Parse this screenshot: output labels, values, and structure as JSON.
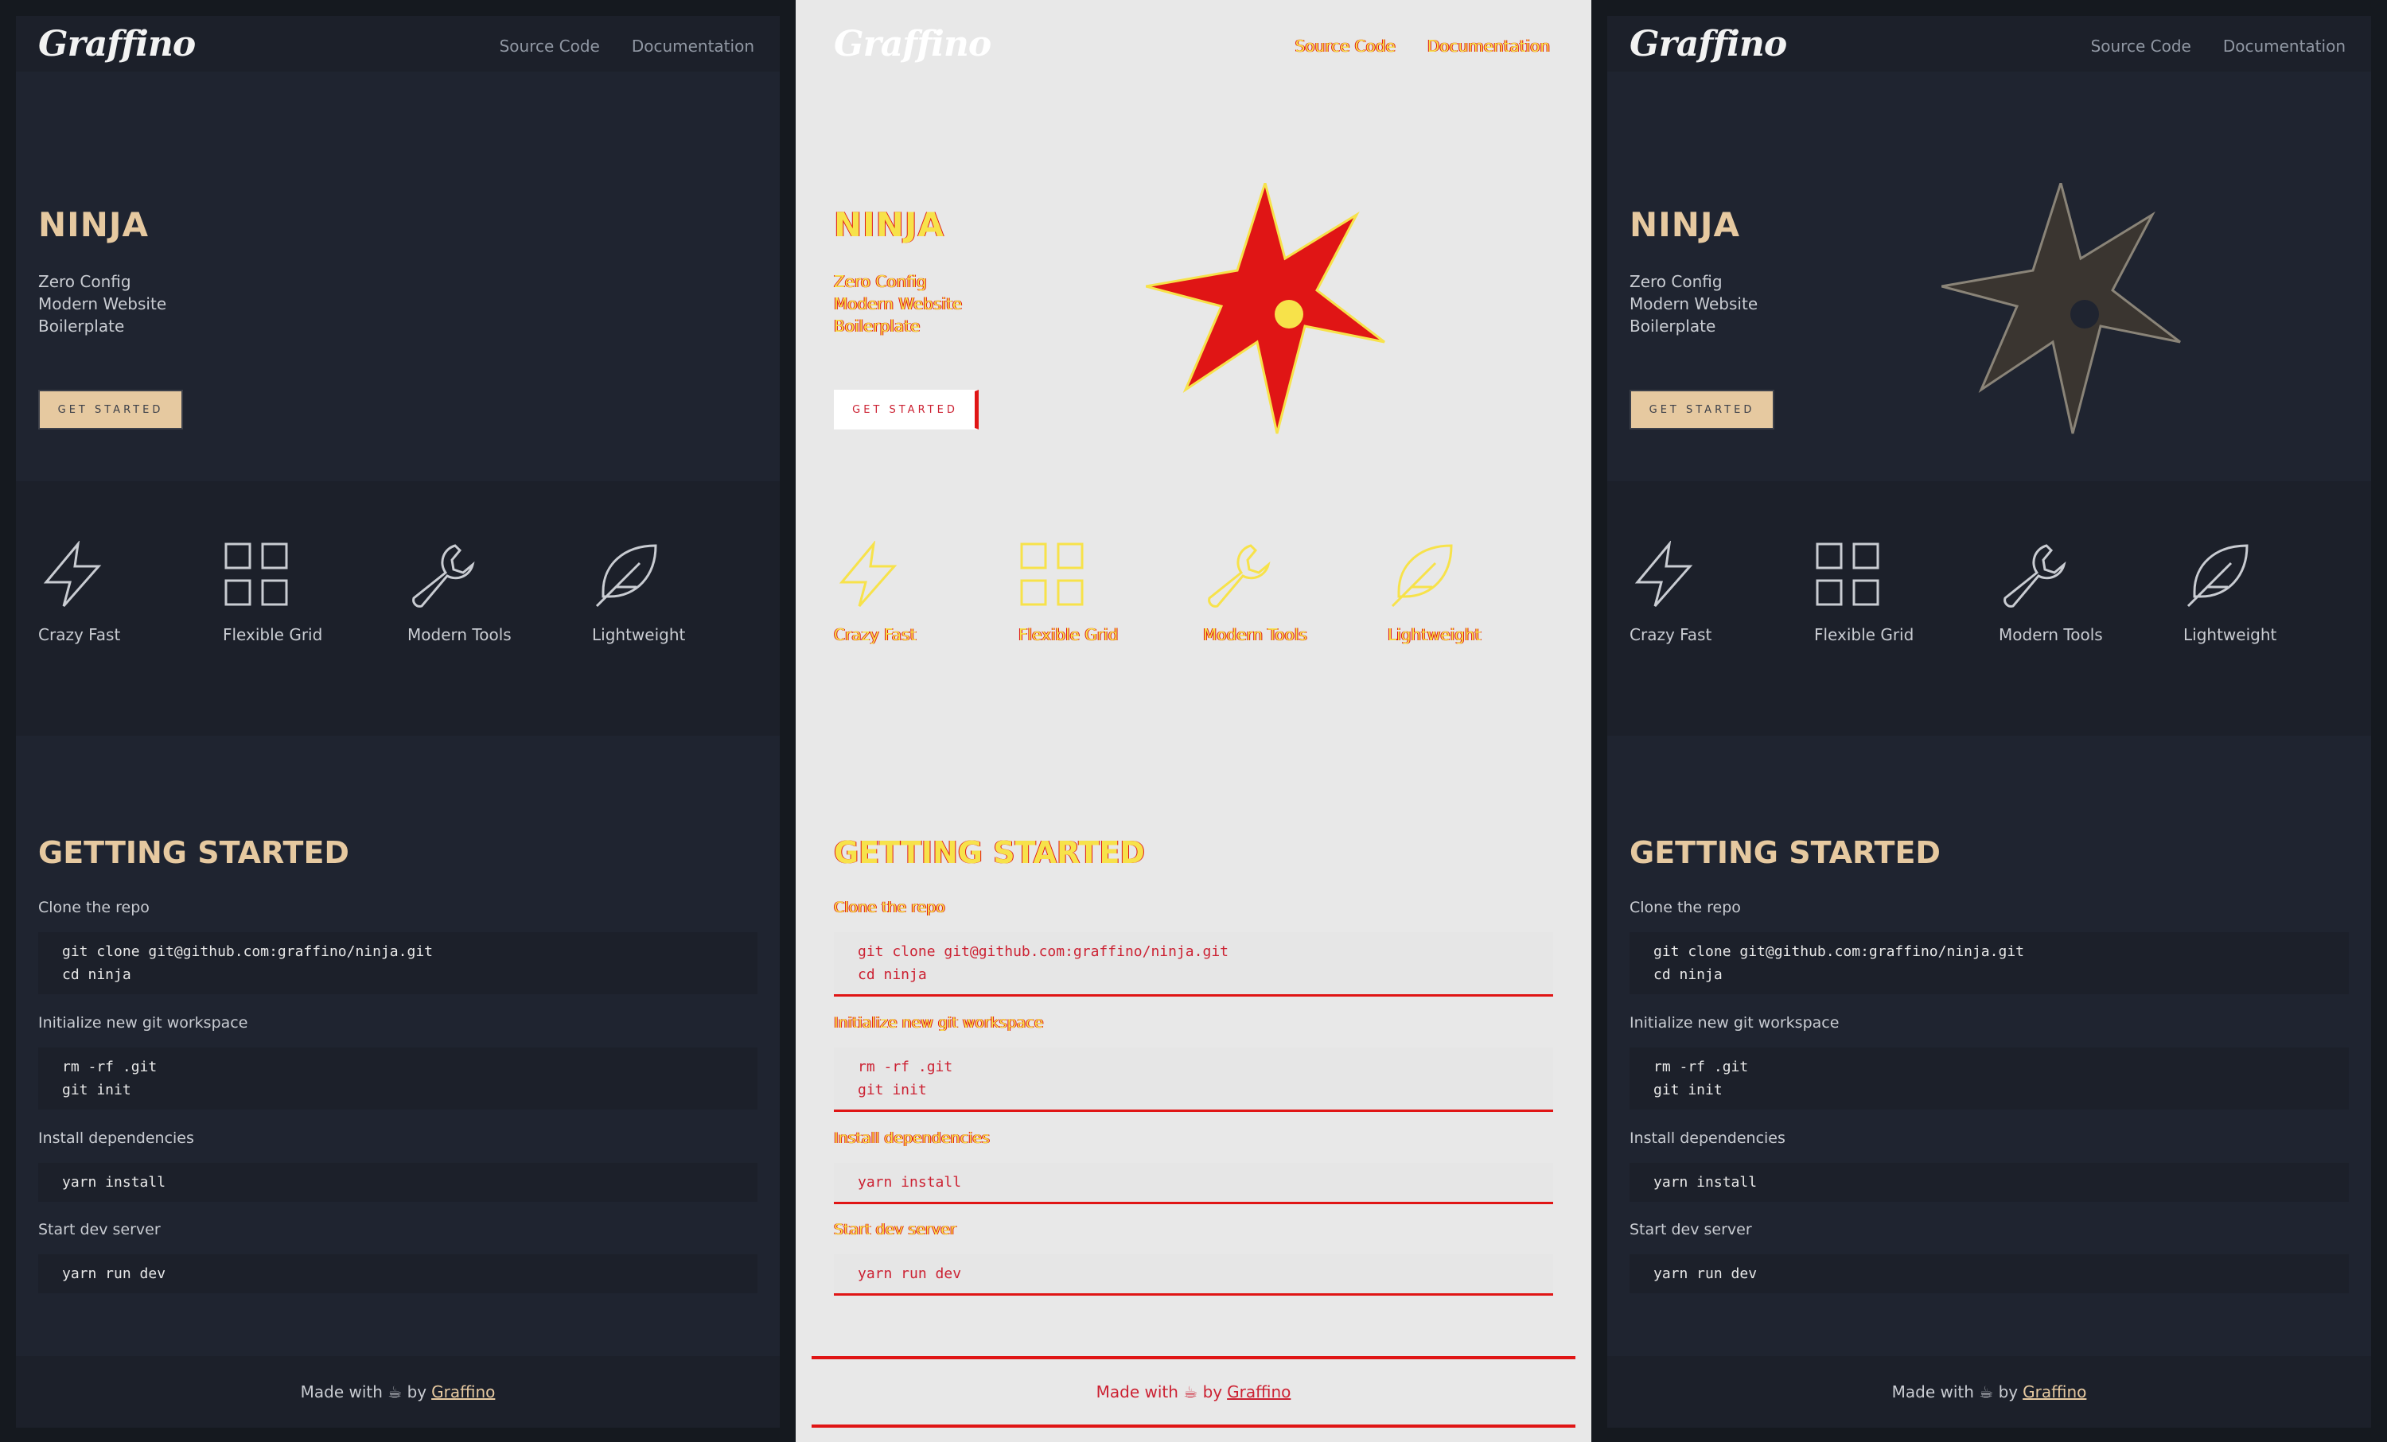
{
  "header": {
    "logo": "Graffino",
    "nav": [
      "Source Code",
      "Documentation"
    ]
  },
  "hero": {
    "title": "NINJA",
    "subtitle": [
      "Zero Config",
      "Modern Website",
      "Boilerplate"
    ],
    "cta": "GET STARTED"
  },
  "features": [
    {
      "label": "Crazy Fast",
      "icon": "lightning-icon"
    },
    {
      "label": "Flexible Grid",
      "icon": "grid-icon"
    },
    {
      "label": "Modern Tools",
      "icon": "wrench-icon"
    },
    {
      "label": "Lightweight",
      "icon": "feather-icon"
    }
  ],
  "getting_started": {
    "title": "GETTING STARTED",
    "steps": [
      {
        "label": "Clone the repo",
        "code": [
          "git clone git@github.com:graffino/ninja.git",
          "cd ninja"
        ]
      },
      {
        "label": "Initialize new git workspace",
        "code": [
          "rm -rf .git",
          "git init"
        ]
      },
      {
        "label": "Install dependencies",
        "code": [
          "yarn install"
        ]
      },
      {
        "label": "Start dev server",
        "code": [
          "yarn run dev"
        ]
      }
    ]
  },
  "footer": {
    "text": "Made with ☕ by",
    "link": "Graffino"
  },
  "colors": {
    "accent": "#e6c9a0",
    "page_bg": "#1f2430",
    "diff_bg": "#e8e8e8",
    "diff_red": "#e01515",
    "diff_yellow": "#f7e24a"
  }
}
